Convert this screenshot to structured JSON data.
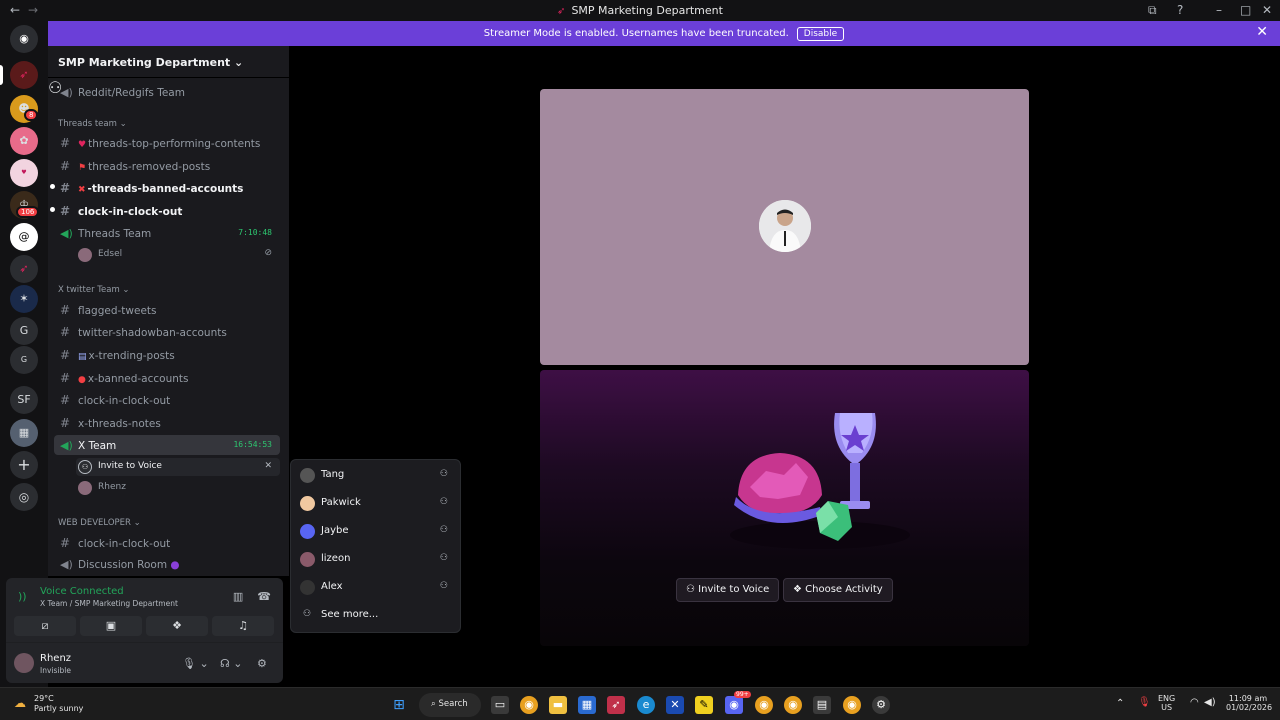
{
  "window": {
    "title": "SMP Marketing Department"
  },
  "banner": {
    "message": "Streamer Mode is enabled. Usernames have been truncated.",
    "button": "Disable"
  },
  "server_rail": {
    "badges": [
      "8",
      "106"
    ],
    "letters": [
      "G",
      "G",
      "SF"
    ]
  },
  "server": {
    "name": "SMP Marketing Department"
  },
  "channels": {
    "reddit_team": "Reddit/Redgifs Team",
    "threads_cat": "Threads team",
    "threads_top": "threads-top-performing-contents",
    "threads_removed": "threads-removed-posts",
    "threads_banned": "-threads-banned-accounts",
    "threads_clock": "clock-in-clock-out",
    "threads_voice": "Threads Team",
    "threads_voice_time": "7:10:48",
    "threads_member": "Edsel",
    "x_cat": "X twitter Team",
    "flagged": "flagged-tweets",
    "shadowban": "twitter-shadowban-accounts",
    "trending": "x-trending-posts",
    "x_banned": "x-banned-accounts",
    "x_clock": "clock-in-clock-out",
    "x_notes": "x-threads-notes",
    "x_voice": "X Team",
    "x_voice_time": "16:54:53",
    "invite": "Invite to Voice",
    "x_member": "Rhenz",
    "web_cat": "WEB DEVELOPER",
    "web_clock": "clock-in-clock-out",
    "discussion": "Discussion Room"
  },
  "voice": {
    "status": "Voice Connected",
    "location": "X Team / SMP Marketing Department"
  },
  "user": {
    "name": "Rhenz",
    "status": "Invisible"
  },
  "stage": {
    "invite_button": "Invite to Voice",
    "activity_button": "Choose Activity"
  },
  "invite_popup": {
    "items": [
      "Tang",
      "Pakwick",
      "Jaybe",
      "lizeon",
      "Alex"
    ],
    "see_more": "See more..."
  },
  "taskbar": {
    "temp": "29°C",
    "weather": "Partly sunny",
    "search": "Search",
    "lang": "ENG",
    "region": "US",
    "time": "11:09 am",
    "date": "01/02/2026",
    "edge_badge": "99+"
  },
  "colors": {
    "accent": "#6b3fd8",
    "online": "#23a55a",
    "stage_tile": "#a48a9f"
  }
}
